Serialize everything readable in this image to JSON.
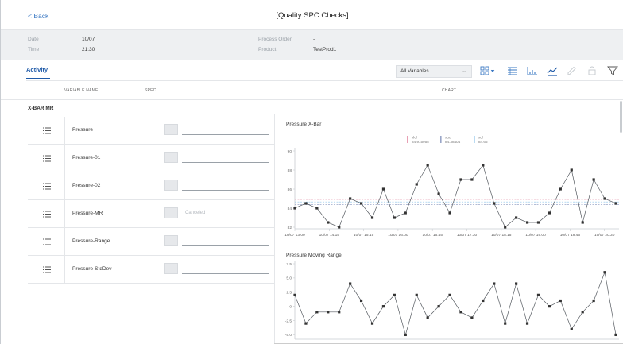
{
  "header": {
    "back_label": "< Back",
    "title": "[Quality SPC Checks]"
  },
  "info": {
    "date_label": "Date",
    "date_value": "10/07",
    "time_label": "Time",
    "time_value": "21:30",
    "process_order_label": "Process Order",
    "process_order_value": "-",
    "product_label": "Product",
    "product_value": "TestProd1"
  },
  "toolbar": {
    "tab_activity": "Activity",
    "variable_select": "All Variables",
    "icons": [
      "grid-view-icon",
      "list-view-icon",
      "bar-chart-icon",
      "line-chart-icon",
      "edit-icon",
      "lock-icon",
      "filter-icon"
    ]
  },
  "columns": {
    "variable_name": "VARIABLE NAME",
    "spec": "SPEC",
    "chart": "CHART"
  },
  "group": {
    "name": "X-BAR MR"
  },
  "rows": [
    {
      "name": "Pressure",
      "value": ""
    },
    {
      "name": "Pressure-01",
      "value": ""
    },
    {
      "name": "Pressure-02",
      "value": ""
    },
    {
      "name": "Pressure-MR",
      "value": "Canceled"
    },
    {
      "name": "Pressure-Range",
      "value": ""
    },
    {
      "name": "Pressure-StdDev",
      "value": ""
    }
  ],
  "colors": {
    "accent": "#1f5aa8",
    "line": "#555a60",
    "ucl": "#e8a0b4",
    "xcl": "#9aa6c8",
    "lcl": "#8cc3e8"
  },
  "chart_data": [
    {
      "type": "line",
      "title": "Pressure X-Bar",
      "legend": [
        {
          "name": "xlcl",
          "value": "84.915955",
          "color": "#e8a0b4"
        },
        {
          "name": "xucl",
          "value": "84.38404",
          "color": "#9aa6c8"
        },
        {
          "name": "xcl",
          "value": "84.65",
          "color": "#8cc3e8"
        }
      ],
      "control_limits": [
        84.915955,
        84.38404,
        84.65
      ],
      "ylim": [
        82,
        90
      ],
      "yticks": [
        "90",
        "88",
        "86",
        "84",
        "82"
      ],
      "xticks": [
        "10/07 13:00",
        "10/07 14:15",
        "10/07 15:15",
        "10/07 16:00",
        "10/07 16:45",
        "10/07 17:30",
        "10/07 18:15",
        "10/07 19:00",
        "10/07 19:45",
        "10/07 20:30"
      ],
      "values": [
        84,
        84.5,
        84,
        82.5,
        82,
        85,
        84.5,
        83,
        86,
        83,
        83.5,
        86.5,
        88.5,
        85.5,
        83.5,
        87,
        87,
        88.5,
        84.5,
        82,
        83,
        82.5,
        82.5,
        83.5,
        86,
        88,
        82.5,
        87,
        85,
        84.5
      ]
    },
    {
      "type": "line",
      "title": "Pressure Moving Range",
      "ylim": [
        -5.5,
        7.5
      ],
      "yticks": [
        "7.5",
        "5.0",
        "2.5",
        "0",
        "-2.5",
        "-5.0"
      ],
      "values": [
        2,
        -3,
        -1,
        -1,
        -1,
        4,
        1,
        -3,
        0,
        2,
        -5,
        2,
        -2,
        0,
        2,
        -1,
        -2,
        1,
        4,
        -3,
        4,
        -3,
        2,
        0,
        1,
        -4,
        -1,
        1,
        6,
        -5
      ]
    }
  ]
}
